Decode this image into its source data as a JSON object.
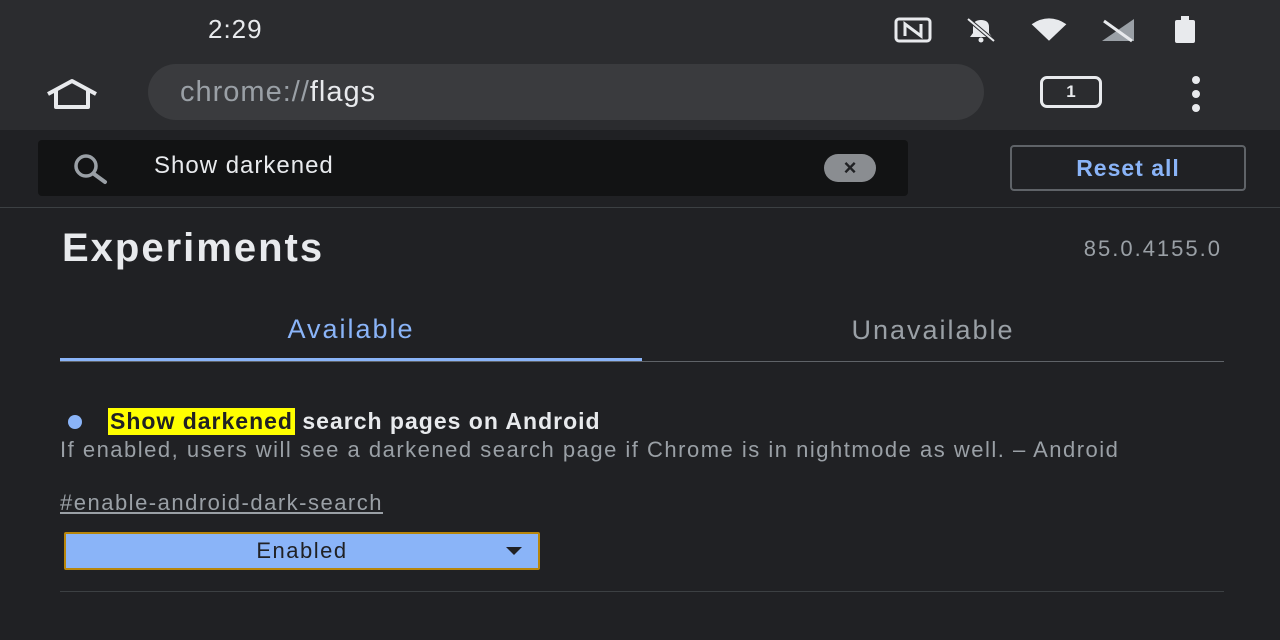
{
  "status_bar": {
    "time": "2:29",
    "icons": [
      "nfc-icon",
      "bell-off-icon",
      "wifi-icon",
      "no-signal-icon",
      "battery-icon"
    ]
  },
  "toolbar": {
    "url_scheme": "chrome://",
    "url_host": "flags",
    "tab_count": "1"
  },
  "search": {
    "value": "Show darkened",
    "reset_label": "Reset all"
  },
  "header": {
    "title": "Experiments",
    "version": "85.0.4155.0"
  },
  "tabs": [
    {
      "label": "Available",
      "active": true
    },
    {
      "label": "Unavailable",
      "active": false
    }
  ],
  "flag": {
    "title_highlight": "Show darkened",
    "title_rest": " search pages on Android",
    "description": "If enabled, users will see a darkened search page if Chrome is in nightmode as well. – Android",
    "link": "#enable-android-dark-search",
    "selected_option": "Enabled"
  },
  "colors": {
    "background": "#202124",
    "accent": "#8ab4f8",
    "highlight": "#ffff00"
  }
}
